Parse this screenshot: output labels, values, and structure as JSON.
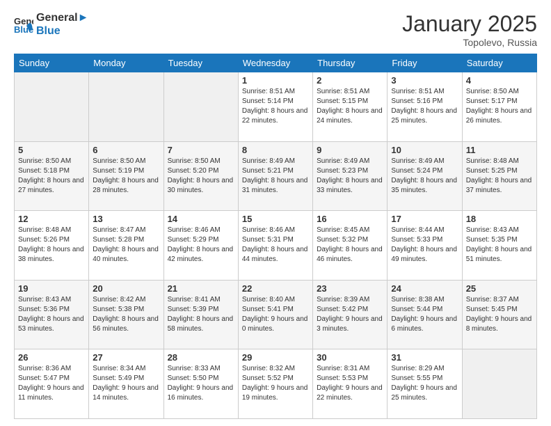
{
  "header": {
    "logo_line1": "General",
    "logo_line2": "Blue",
    "month": "January 2025",
    "location": "Topolevo, Russia"
  },
  "weekdays": [
    "Sunday",
    "Monday",
    "Tuesday",
    "Wednesday",
    "Thursday",
    "Friday",
    "Saturday"
  ],
  "weeks": [
    [
      {
        "day": "",
        "sunrise": "",
        "sunset": "",
        "daylight": "",
        "empty": true
      },
      {
        "day": "",
        "sunrise": "",
        "sunset": "",
        "daylight": "",
        "empty": true
      },
      {
        "day": "",
        "sunrise": "",
        "sunset": "",
        "daylight": "",
        "empty": true
      },
      {
        "day": "1",
        "sunrise": "Sunrise: 8:51 AM",
        "sunset": "Sunset: 5:14 PM",
        "daylight": "Daylight: 8 hours and 22 minutes."
      },
      {
        "day": "2",
        "sunrise": "Sunrise: 8:51 AM",
        "sunset": "Sunset: 5:15 PM",
        "daylight": "Daylight: 8 hours and 24 minutes."
      },
      {
        "day": "3",
        "sunrise": "Sunrise: 8:51 AM",
        "sunset": "Sunset: 5:16 PM",
        "daylight": "Daylight: 8 hours and 25 minutes."
      },
      {
        "day": "4",
        "sunrise": "Sunrise: 8:50 AM",
        "sunset": "Sunset: 5:17 PM",
        "daylight": "Daylight: 8 hours and 26 minutes."
      }
    ],
    [
      {
        "day": "5",
        "sunrise": "Sunrise: 8:50 AM",
        "sunset": "Sunset: 5:18 PM",
        "daylight": "Daylight: 8 hours and 27 minutes."
      },
      {
        "day": "6",
        "sunrise": "Sunrise: 8:50 AM",
        "sunset": "Sunset: 5:19 PM",
        "daylight": "Daylight: 8 hours and 28 minutes."
      },
      {
        "day": "7",
        "sunrise": "Sunrise: 8:50 AM",
        "sunset": "Sunset: 5:20 PM",
        "daylight": "Daylight: 8 hours and 30 minutes."
      },
      {
        "day": "8",
        "sunrise": "Sunrise: 8:49 AM",
        "sunset": "Sunset: 5:21 PM",
        "daylight": "Daylight: 8 hours and 31 minutes."
      },
      {
        "day": "9",
        "sunrise": "Sunrise: 8:49 AM",
        "sunset": "Sunset: 5:23 PM",
        "daylight": "Daylight: 8 hours and 33 minutes."
      },
      {
        "day": "10",
        "sunrise": "Sunrise: 8:49 AM",
        "sunset": "Sunset: 5:24 PM",
        "daylight": "Daylight: 8 hours and 35 minutes."
      },
      {
        "day": "11",
        "sunrise": "Sunrise: 8:48 AM",
        "sunset": "Sunset: 5:25 PM",
        "daylight": "Daylight: 8 hours and 37 minutes."
      }
    ],
    [
      {
        "day": "12",
        "sunrise": "Sunrise: 8:48 AM",
        "sunset": "Sunset: 5:26 PM",
        "daylight": "Daylight: 8 hours and 38 minutes."
      },
      {
        "day": "13",
        "sunrise": "Sunrise: 8:47 AM",
        "sunset": "Sunset: 5:28 PM",
        "daylight": "Daylight: 8 hours and 40 minutes."
      },
      {
        "day": "14",
        "sunrise": "Sunrise: 8:46 AM",
        "sunset": "Sunset: 5:29 PM",
        "daylight": "Daylight: 8 hours and 42 minutes."
      },
      {
        "day": "15",
        "sunrise": "Sunrise: 8:46 AM",
        "sunset": "Sunset: 5:31 PM",
        "daylight": "Daylight: 8 hours and 44 minutes."
      },
      {
        "day": "16",
        "sunrise": "Sunrise: 8:45 AM",
        "sunset": "Sunset: 5:32 PM",
        "daylight": "Daylight: 8 hours and 46 minutes."
      },
      {
        "day": "17",
        "sunrise": "Sunrise: 8:44 AM",
        "sunset": "Sunset: 5:33 PM",
        "daylight": "Daylight: 8 hours and 49 minutes."
      },
      {
        "day": "18",
        "sunrise": "Sunrise: 8:43 AM",
        "sunset": "Sunset: 5:35 PM",
        "daylight": "Daylight: 8 hours and 51 minutes."
      }
    ],
    [
      {
        "day": "19",
        "sunrise": "Sunrise: 8:43 AM",
        "sunset": "Sunset: 5:36 PM",
        "daylight": "Daylight: 8 hours and 53 minutes."
      },
      {
        "day": "20",
        "sunrise": "Sunrise: 8:42 AM",
        "sunset": "Sunset: 5:38 PM",
        "daylight": "Daylight: 8 hours and 56 minutes."
      },
      {
        "day": "21",
        "sunrise": "Sunrise: 8:41 AM",
        "sunset": "Sunset: 5:39 PM",
        "daylight": "Daylight: 8 hours and 58 minutes."
      },
      {
        "day": "22",
        "sunrise": "Sunrise: 8:40 AM",
        "sunset": "Sunset: 5:41 PM",
        "daylight": "Daylight: 9 hours and 0 minutes."
      },
      {
        "day": "23",
        "sunrise": "Sunrise: 8:39 AM",
        "sunset": "Sunset: 5:42 PM",
        "daylight": "Daylight: 9 hours and 3 minutes."
      },
      {
        "day": "24",
        "sunrise": "Sunrise: 8:38 AM",
        "sunset": "Sunset: 5:44 PM",
        "daylight": "Daylight: 9 hours and 6 minutes."
      },
      {
        "day": "25",
        "sunrise": "Sunrise: 8:37 AM",
        "sunset": "Sunset: 5:45 PM",
        "daylight": "Daylight: 9 hours and 8 minutes."
      }
    ],
    [
      {
        "day": "26",
        "sunrise": "Sunrise: 8:36 AM",
        "sunset": "Sunset: 5:47 PM",
        "daylight": "Daylight: 9 hours and 11 minutes."
      },
      {
        "day": "27",
        "sunrise": "Sunrise: 8:34 AM",
        "sunset": "Sunset: 5:49 PM",
        "daylight": "Daylight: 9 hours and 14 minutes."
      },
      {
        "day": "28",
        "sunrise": "Sunrise: 8:33 AM",
        "sunset": "Sunset: 5:50 PM",
        "daylight": "Daylight: 9 hours and 16 minutes."
      },
      {
        "day": "29",
        "sunrise": "Sunrise: 8:32 AM",
        "sunset": "Sunset: 5:52 PM",
        "daylight": "Daylight: 9 hours and 19 minutes."
      },
      {
        "day": "30",
        "sunrise": "Sunrise: 8:31 AM",
        "sunset": "Sunset: 5:53 PM",
        "daylight": "Daylight: 9 hours and 22 minutes."
      },
      {
        "day": "31",
        "sunrise": "Sunrise: 8:29 AM",
        "sunset": "Sunset: 5:55 PM",
        "daylight": "Daylight: 9 hours and 25 minutes."
      },
      {
        "day": "",
        "sunrise": "",
        "sunset": "",
        "daylight": "",
        "empty": true
      }
    ]
  ]
}
